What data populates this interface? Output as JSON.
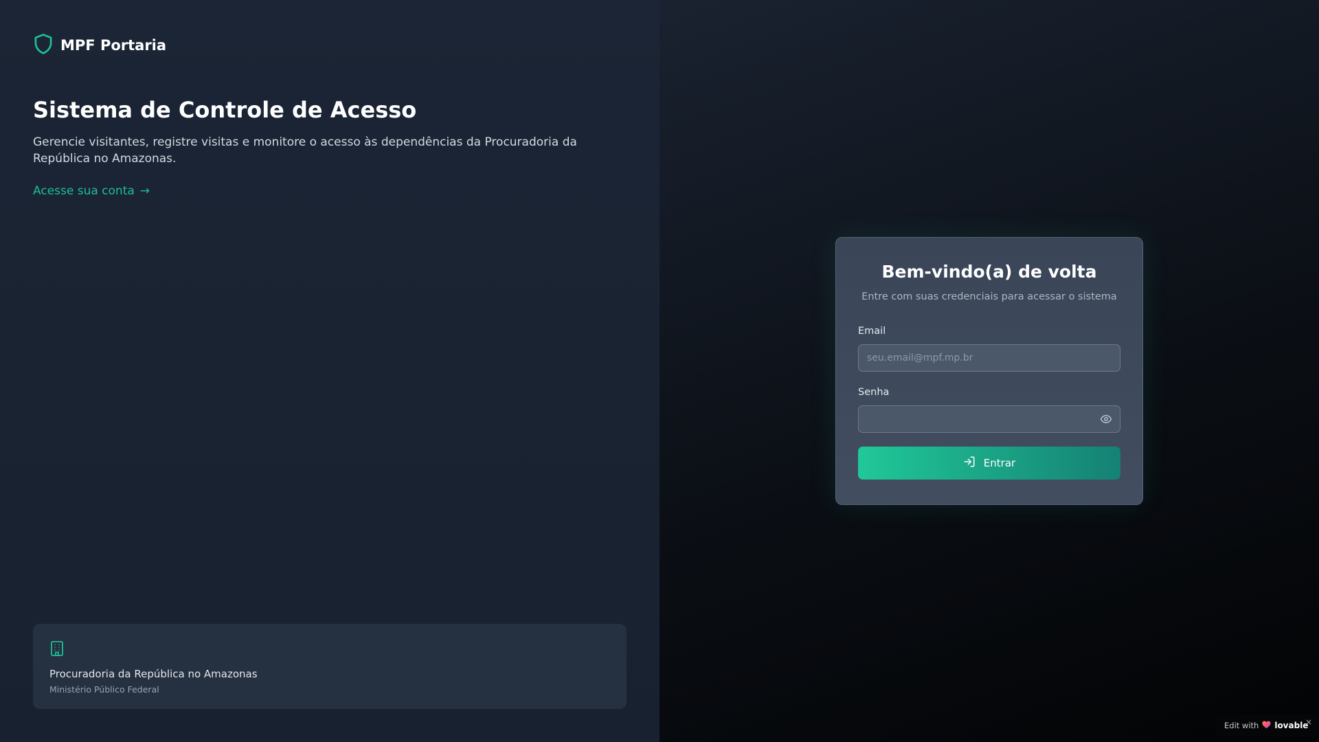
{
  "brand": {
    "name": "MPF Portaria",
    "icon": "shield-icon"
  },
  "hero": {
    "title": "Sistema de Controle de Acesso",
    "description": "Gerencie visitantes, registre visitas e monitore o acesso às dependências da Procuradoria da República no Amazonas.",
    "link_label": "Acesse sua conta",
    "link_arrow": "→"
  },
  "info_card": {
    "icon": "building-icon",
    "title": "Procuradoria da República no Amazonas",
    "subtitle": "Ministério Público Federal"
  },
  "login": {
    "title": "Bem-vindo(a) de volta",
    "subtitle": "Entre com suas credenciais para acessar o sistema",
    "email_label": "Email",
    "email_placeholder": "seu.email@mpf.mp.br",
    "email_value": "",
    "password_label": "Senha",
    "password_value": "",
    "submit_label": "Entrar"
  },
  "badge": {
    "prefix": "Edit with",
    "brand": "lovable",
    "close": "×"
  },
  "colors": {
    "accent": "#1fbf95",
    "button_start": "#20c898",
    "button_end": "#158174"
  }
}
